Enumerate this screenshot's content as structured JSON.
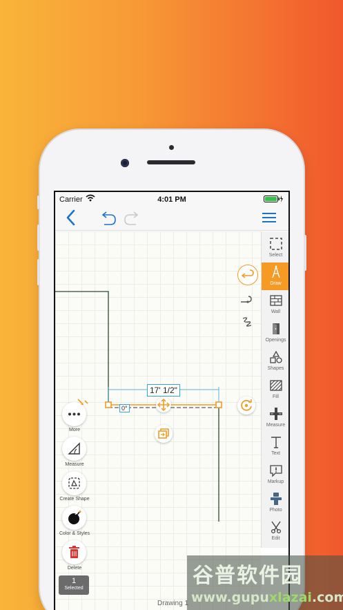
{
  "colors": {
    "accent": "#f59a23",
    "nav_blue": "#1a73c9",
    "drawing_line": "#2f4a2f",
    "dim_line": "#3aa0d8"
  },
  "status_bar": {
    "carrier": "Carrier",
    "time": "4:01 PM"
  },
  "nav": {
    "back_icon": "chevron-left-icon",
    "undo_icon": "undo-icon",
    "redo_icon": "redo-icon",
    "menu_icon": "hamburger-menu-icon"
  },
  "canvas": {
    "dimension_label": "17' 1/2\"",
    "angle_label": "0°"
  },
  "draw_modes": [
    "loop-line-icon",
    "line-curve-icon",
    "freehand-icon"
  ],
  "toolbar": {
    "items": [
      {
        "label": "Select",
        "icon": "select-icon"
      },
      {
        "label": "Draw",
        "icon": "draw-icon",
        "active": true
      },
      {
        "label": "Wall",
        "icon": "wall-icon"
      },
      {
        "label": "Openings",
        "icon": "door-icon"
      },
      {
        "label": "Shapes",
        "icon": "shapes-icon"
      },
      {
        "label": "Fill",
        "icon": "fill-icon"
      },
      {
        "label": "Measure",
        "icon": "measure-icon"
      },
      {
        "label": "Text",
        "icon": "text-icon"
      },
      {
        "label": "Markup",
        "icon": "markup-icon"
      },
      {
        "label": "Photo",
        "icon": "photo-icon"
      },
      {
        "label": "Edit",
        "icon": "scissors-icon"
      }
    ]
  },
  "left_tools": {
    "items": [
      {
        "label": "More",
        "icon": "more-icon"
      },
      {
        "label": "Measure",
        "icon": "measure-angle-icon"
      },
      {
        "label": "Create Shape",
        "icon": "create-shape-icon"
      },
      {
        "label": "Color & Styles",
        "icon": "color-styles-icon"
      },
      {
        "label": "Delete",
        "icon": "trash-icon"
      }
    ]
  },
  "selection": {
    "count": "1",
    "label": "Selected"
  },
  "footer": {
    "drawing_title": "Drawing 1"
  },
  "watermark": {
    "cn": "谷普软件园",
    "url_a": "www.gupu",
    "url_b": "xlazai",
    "url_c": ".com"
  }
}
